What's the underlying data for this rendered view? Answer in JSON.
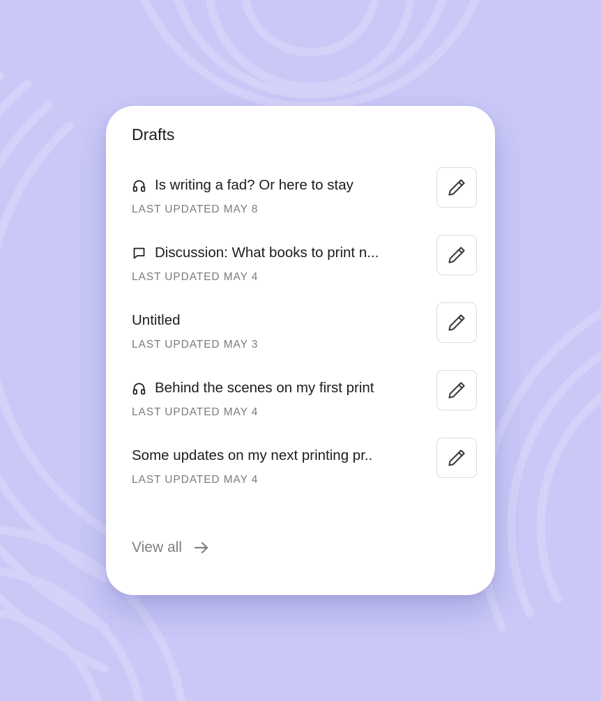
{
  "card": {
    "title": "Drafts",
    "view_all_label": "View all"
  },
  "drafts": [
    {
      "icon": "headphones-icon",
      "title": "Is writing a fad? Or here to stay",
      "meta": "LAST UPDATED MAY 8"
    },
    {
      "icon": "chat-bubble-icon",
      "title": "Discussion: What books to print n...",
      "meta": "LAST UPDATED MAY 4"
    },
    {
      "icon": "",
      "title": "Untitled",
      "meta": "LAST UPDATED MAY 3"
    },
    {
      "icon": "headphones-icon",
      "title": "Behind the scenes on my first print",
      "meta": "LAST UPDATED MAY 4"
    },
    {
      "icon": "",
      "title": "Some updates on my next printing pr..",
      "meta": "LAST UPDATED MAY 4"
    }
  ],
  "colors": {
    "background": "#c9c8f7",
    "card": "#ffffff",
    "text_primary": "#1c1c1c",
    "text_muted": "#7b7b7b"
  }
}
